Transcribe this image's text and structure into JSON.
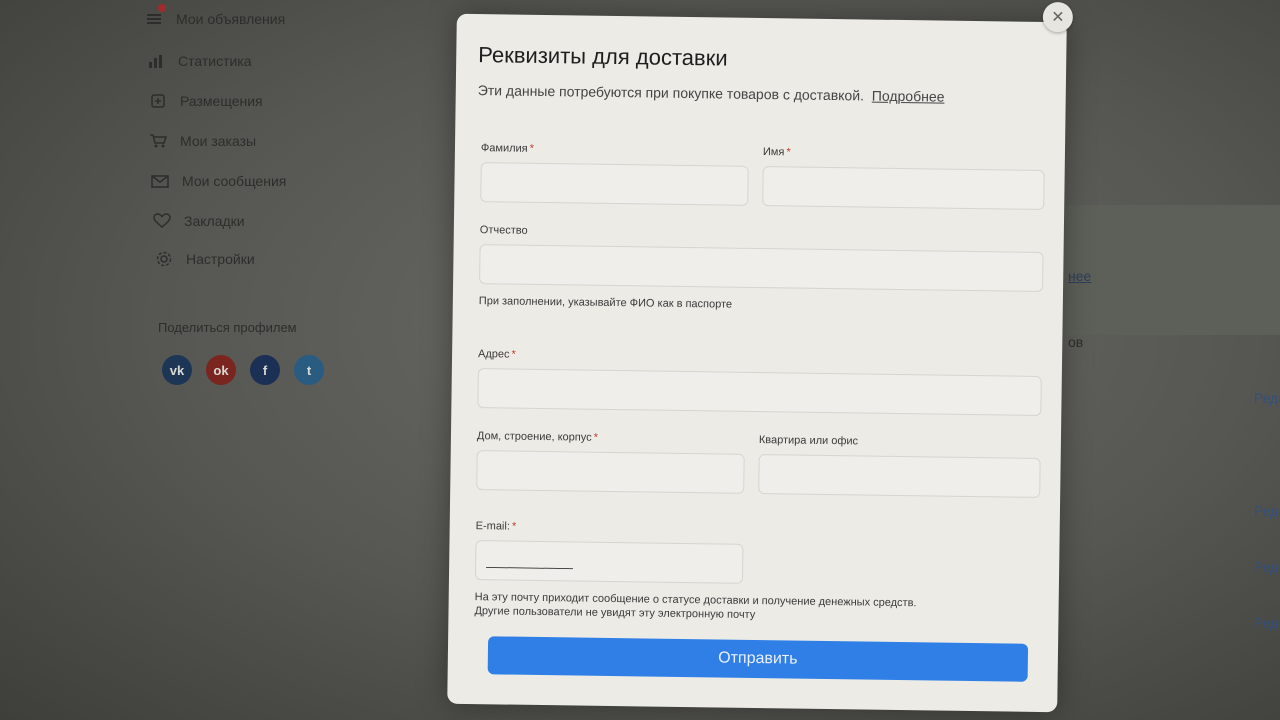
{
  "sidebar": {
    "items": [
      {
        "label": "Мои объявления",
        "icon": "listing-icon",
        "has_badge": true
      },
      {
        "label": "Статистика",
        "icon": "stats-icon"
      },
      {
        "label": "Размещения",
        "icon": "placement-icon"
      },
      {
        "label": "Мои заказы",
        "icon": "cart-icon"
      },
      {
        "label": "Мои сообщения",
        "icon": "mail-icon"
      },
      {
        "label": "Закладки",
        "icon": "heart-icon"
      },
      {
        "label": "Настройки",
        "icon": "gear-icon"
      }
    ],
    "share_title": "Поделиться профилем",
    "socials": [
      {
        "name": "vk",
        "glyph": "vk"
      },
      {
        "name": "odnoklassniki",
        "glyph": "ok"
      },
      {
        "name": "facebook",
        "glyph": "f"
      },
      {
        "name": "twitter",
        "glyph": "t"
      }
    ]
  },
  "background": {
    "fragments": [
      "нее",
      "ов"
    ],
    "edit_label": "Реда"
  },
  "modal": {
    "title": "Реквизиты для доставки",
    "subtitle": "Эти данные потребуются при покупке товаров с доставкой.",
    "subtitle_link": "Подробнее",
    "fields": {
      "last_name": {
        "label": "Фамилия",
        "required": "*",
        "value": ""
      },
      "first_name": {
        "label": "Имя",
        "required": "*",
        "value": ""
      },
      "middle_name": {
        "label": "Отчество",
        "required": "",
        "value": ""
      },
      "fio_hint": "При заполнении, указывайте ФИО как в паспорте",
      "address": {
        "label": "Адрес",
        "required": "*",
        "value": ""
      },
      "house": {
        "label": "Дом, строение, корпус",
        "required": "*",
        "value": ""
      },
      "apartment": {
        "label": "Квартира или офис",
        "required": "",
        "value": ""
      },
      "email": {
        "label": "E-mail:",
        "required": "*",
        "value": "____________"
      }
    },
    "email_hint_1": "На эту почту приходит сообщение о статусе доставки и получение денежных средств.",
    "email_hint_2": "Другие пользователи не увидят эту электронную почту",
    "submit_label": "Отправить",
    "close_glyph": "✕"
  },
  "colors": {
    "accent": "#2f7fe6",
    "required": "#c0392b"
  }
}
